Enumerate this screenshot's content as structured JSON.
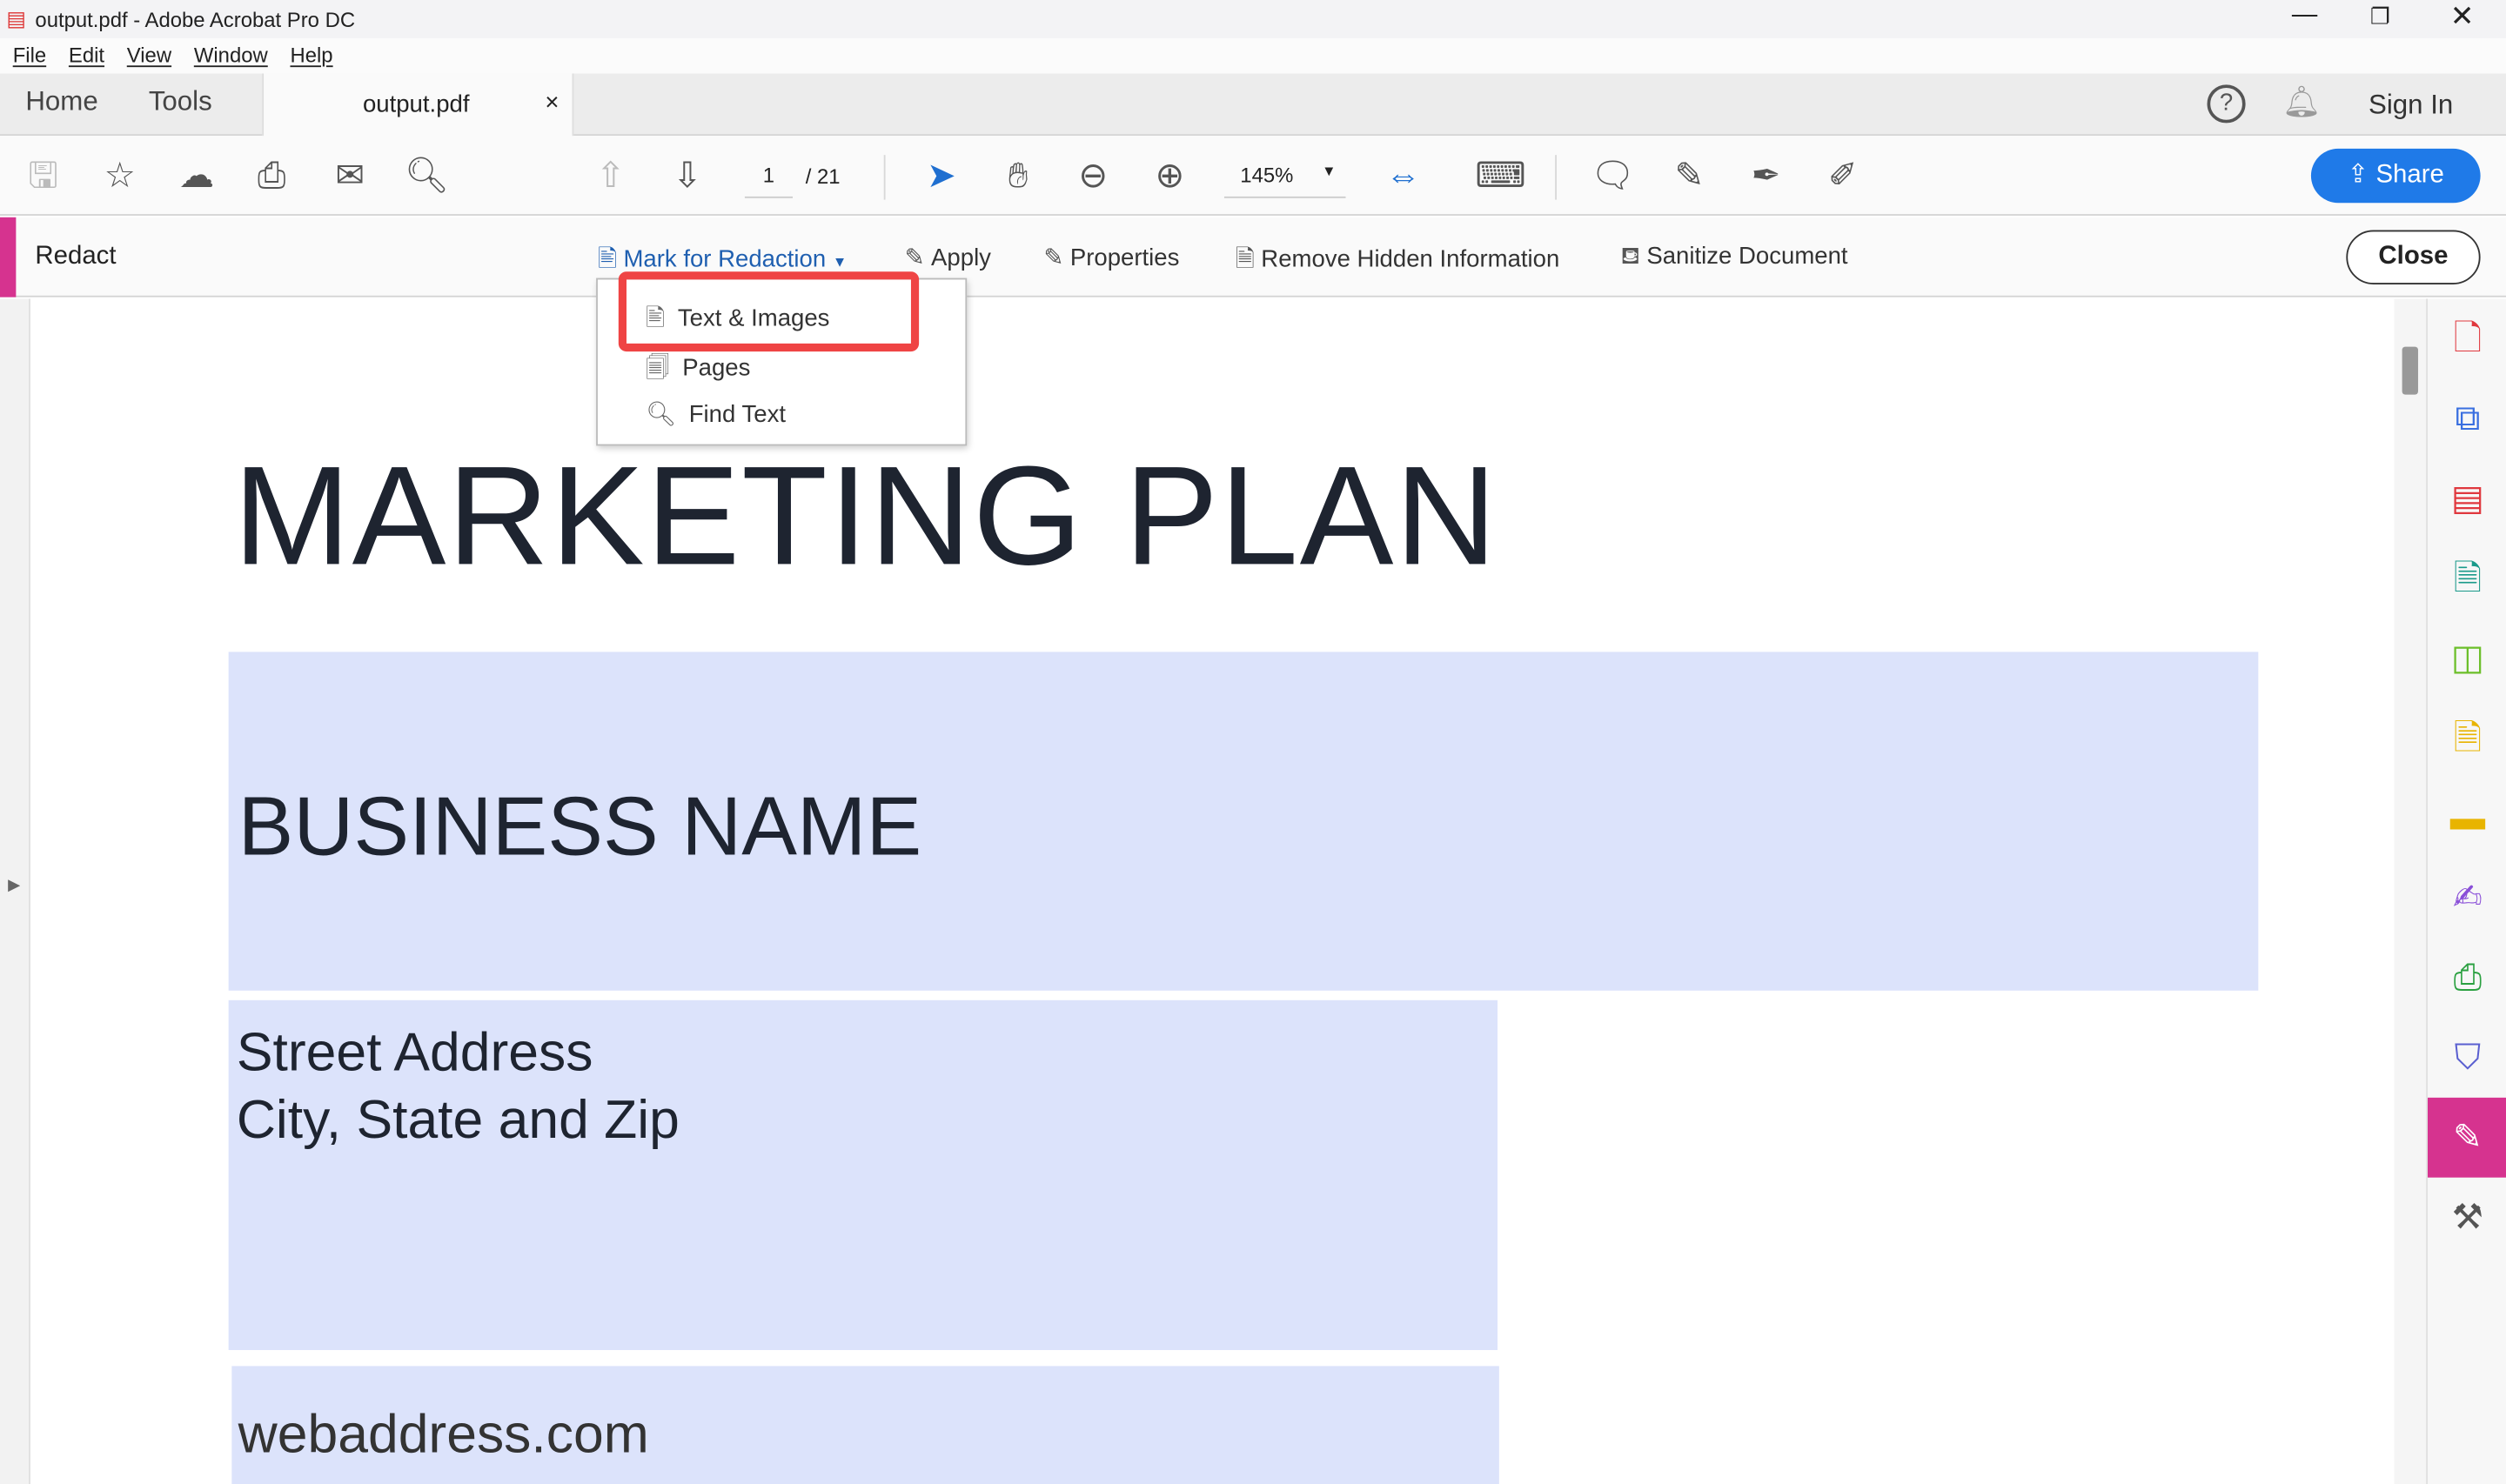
{
  "window": {
    "title": "output.pdf - Adobe Acrobat Pro DC",
    "controls": [
      "minimize",
      "restore",
      "close"
    ]
  },
  "menubar": [
    "File",
    "Edit",
    "View",
    "Window",
    "Help"
  ],
  "tabs": {
    "home": "Home",
    "tools": "Tools",
    "document": "output.pdf",
    "close": "×"
  },
  "header_right": {
    "sign_in": "Sign In"
  },
  "toolbar": {
    "page_current": "1",
    "page_total": "/ 21",
    "zoom": "145%",
    "share": "Share"
  },
  "redact_bar": {
    "title": "Redact",
    "mark": "Mark for Redaction",
    "apply": "Apply",
    "properties": "Properties",
    "remove_hidden": "Remove Hidden Information",
    "sanitize": "Sanitize Document",
    "close": "Close"
  },
  "dropdown": {
    "items": [
      "Text & Images",
      "Pages",
      "Find Text"
    ],
    "highlighted": "Text & Images"
  },
  "document": {
    "title": "MARKETING PLAN",
    "business": "BUSINESS NAME",
    "address1": "Street Address",
    "address2": "City, State and Zip",
    "web": "webaddress.com"
  },
  "colors": {
    "accent": "#1f7ae8",
    "redact": "#d6338f",
    "highlight": "#ef4444",
    "field": "#dce3fb"
  }
}
